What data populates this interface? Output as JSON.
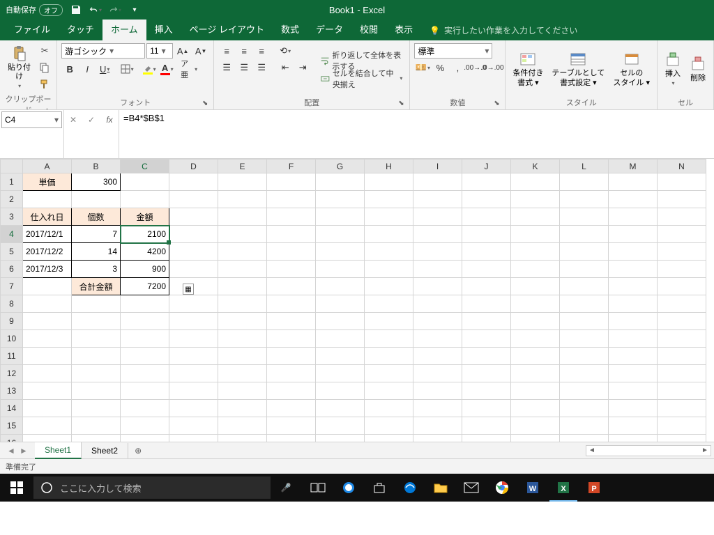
{
  "titlebar": {
    "autosave_label": "自動保存",
    "autosave_state": "オフ",
    "title": "Book1 - Excel"
  },
  "menu": {
    "file": "ファイル",
    "touch": "タッチ",
    "home": "ホーム",
    "insert": "挿入",
    "layout": "ページ レイアウト",
    "formula": "数式",
    "data": "データ",
    "review": "校閲",
    "view": "表示",
    "tellme": "実行したい作業を入力してください"
  },
  "ribbon": {
    "clipboard": {
      "paste": "貼り付け",
      "label": "クリップボード"
    },
    "font": {
      "name": "游ゴシック",
      "size": "11",
      "label": "フォント"
    },
    "alignment": {
      "wrap": "折り返して全体を表示する",
      "merge": "セルを結合して中央揃え",
      "label": "配置"
    },
    "number": {
      "format": "標準",
      "label": "数値"
    },
    "styles": {
      "cond": "条件付き\n書式 ▾",
      "table": "テーブルとして\n書式設定 ▾",
      "cell": "セルの\nスタイル ▾",
      "label": "スタイル"
    },
    "cells": {
      "insert": "挿入",
      "delete": "削除",
      "label": "セル"
    }
  },
  "formula_bar": {
    "name_box": "C4",
    "formula": "=B4*$B$1"
  },
  "columns": [
    "A",
    "B",
    "C",
    "D",
    "E",
    "F",
    "G",
    "H",
    "I",
    "J",
    "K",
    "L",
    "M",
    "N"
  ],
  "rows_visible": 16,
  "sheet": {
    "A1": "単価",
    "B1": "300",
    "A3": "仕入れ日",
    "B3": "個数",
    "C3": "金額",
    "A4": "2017/12/1",
    "B4": "7",
    "C4": "2100",
    "A5": "2017/12/2",
    "B5": "14",
    "C5": "4200",
    "A6": "2017/12/3",
    "B6": "3",
    "C6": "900",
    "B7": "合計金額",
    "C7": "7200"
  },
  "tabs": {
    "sheet1": "Sheet1",
    "sheet2": "Sheet2"
  },
  "status": {
    "ready": "準備完了"
  },
  "taskbar": {
    "search_placeholder": "ここに入力して検索"
  }
}
